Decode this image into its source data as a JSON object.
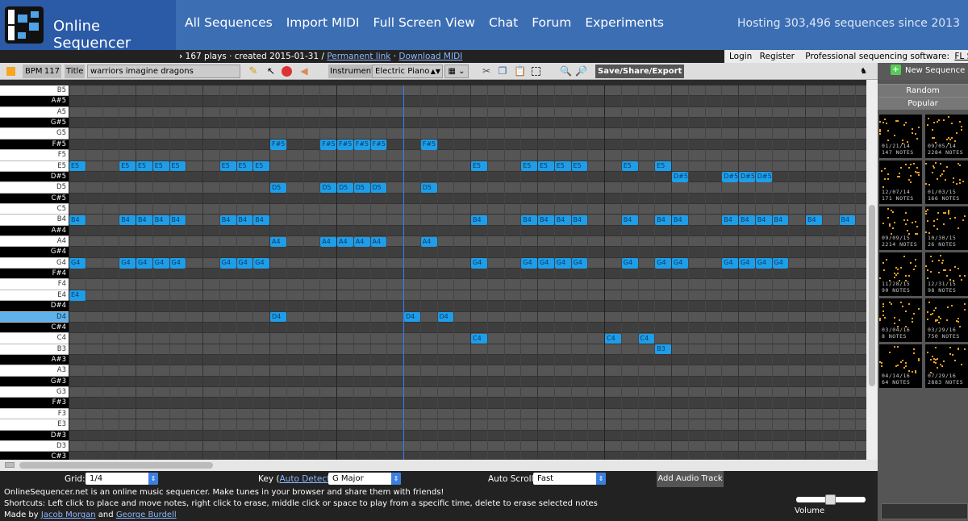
{
  "header": {
    "logo_text": "Online Sequencer",
    "nav": [
      "All Sequences",
      "Import MIDI",
      "Full Screen View",
      "Chat",
      "Forum",
      "Experiments"
    ],
    "hosting": "Hosting 303,496 sequences since 2013"
  },
  "subbar": {
    "info": "167 plays · created 2015-01-31 /",
    "permanent_link": "Permanent link",
    "sep": "·",
    "download_midi": "Download MIDI",
    "login": "Login",
    "register": "Register",
    "pro_text": "Professional sequencing software:",
    "fl_studio": "FL Studio"
  },
  "toolbar": {
    "bpm_label": "BPM",
    "bpm_value": "117",
    "title_label": "Title",
    "title_value": "warriors imagine dragons",
    "instrument_label": "Instrument",
    "instrument_value": "Electric Piano",
    "save_label": "Save/Share/Export"
  },
  "sidebar": {
    "new_sequence": "New Sequence",
    "random": "Random",
    "popular": "Popular",
    "thumbnails": [
      {
        "date": "01/21/14",
        "notes": "147 NOTES"
      },
      {
        "date": "09/05/14",
        "notes": "2284 NOTES"
      },
      {
        "date": "12/07/14",
        "notes": "171 NOTES"
      },
      {
        "date": "01/03/15",
        "notes": "166 NOTES"
      },
      {
        "date": "09/09/15",
        "notes": "2214 NOTES"
      },
      {
        "date": "10/30/15",
        "notes": "26 NOTES"
      },
      {
        "date": "11/28/15",
        "notes": "90 NOTES"
      },
      {
        "date": "12/31/15",
        "notes": "98 NOTES"
      },
      {
        "date": "03/04/16",
        "notes": "8 NOTES"
      },
      {
        "date": "03/29/16",
        "notes": "750 NOTES"
      },
      {
        "date": "04/14/16",
        "notes": "64 NOTES"
      },
      {
        "date": "07/29/16",
        "notes": "2883 NOTES"
      }
    ]
  },
  "piano": {
    "keys": [
      "B5",
      "A#5",
      "A5",
      "G#5",
      "G5",
      "F#5",
      "F5",
      "E5",
      "D#5",
      "D5",
      "C#5",
      "C5",
      "B4",
      "A#4",
      "A4",
      "G#4",
      "G4",
      "F#4",
      "F4",
      "E4",
      "D#4",
      "D4",
      "C#4",
      "C4",
      "B3",
      "A#3",
      "A3",
      "G#3",
      "G3",
      "F#3",
      "F3",
      "E3",
      "D#3",
      "D3",
      "C#3"
    ],
    "highlighted_key": "D4"
  },
  "notes": [
    {
      "pitch": "E5",
      "steps": [
        0,
        3,
        4,
        5,
        6,
        9,
        10,
        11,
        24,
        27,
        28,
        29,
        30,
        33,
        35
      ]
    },
    {
      "pitch": "F#5",
      "steps": [
        12,
        15,
        16,
        17,
        18,
        21
      ]
    },
    {
      "pitch": "D#5",
      "steps": [
        36,
        39,
        40,
        41
      ]
    },
    {
      "pitch": "D5",
      "steps": [
        12,
        15,
        16,
        17,
        18,
        21
      ]
    },
    {
      "pitch": "B4",
      "steps": [
        0,
        3,
        4,
        5,
        6,
        9,
        10,
        11,
        24,
        27,
        28,
        29,
        30,
        33,
        35,
        36,
        39,
        40,
        41,
        42,
        44,
        46,
        48,
        50
      ]
    },
    {
      "pitch": "A4",
      "steps": [
        12,
        15,
        16,
        17,
        18,
        21
      ]
    },
    {
      "pitch": "G4",
      "steps": [
        0,
        3,
        4,
        5,
        6,
        9,
        10,
        11,
        24,
        27,
        28,
        29,
        30,
        33,
        35,
        36,
        39,
        40,
        41,
        42
      ]
    },
    {
      "pitch": "E4",
      "steps": [
        0
      ]
    },
    {
      "pitch": "D4",
      "steps": [
        12,
        20,
        22
      ]
    },
    {
      "pitch": "C4",
      "steps": [
        24,
        32,
        34
      ]
    },
    {
      "pitch": "B3",
      "steps": [
        35
      ]
    }
  ],
  "controls": {
    "grid_label": "Grid:",
    "grid_value": "1/4",
    "key_label": "Key (",
    "auto_detect": "Auto Detect",
    "key_label_end": "):",
    "key_value": "G Major",
    "autoscroll_label": "Auto Scroll:",
    "autoscroll_value": "Fast",
    "add_audio": "Add Audio Track",
    "volume_label": "Volume"
  },
  "footer": {
    "line1": "OnlineSequencer.net is an online music sequencer. Make tunes in your browser and share them with friends!",
    "line2": "Shortcuts: Left click to place and move notes, right click to erase, middle click or space to play from a specific time, delete to erase selected notes",
    "made_by": "Made by",
    "author1": "Jacob Morgan",
    "and": "and",
    "author2": "George Burdell"
  },
  "colors": {
    "header_bg": "#3c6eb4",
    "note": "#1e9ee8",
    "note_text": "#0a3a66",
    "playhead": "#2f7fff",
    "highlight_key": "#5fb3ea"
  }
}
